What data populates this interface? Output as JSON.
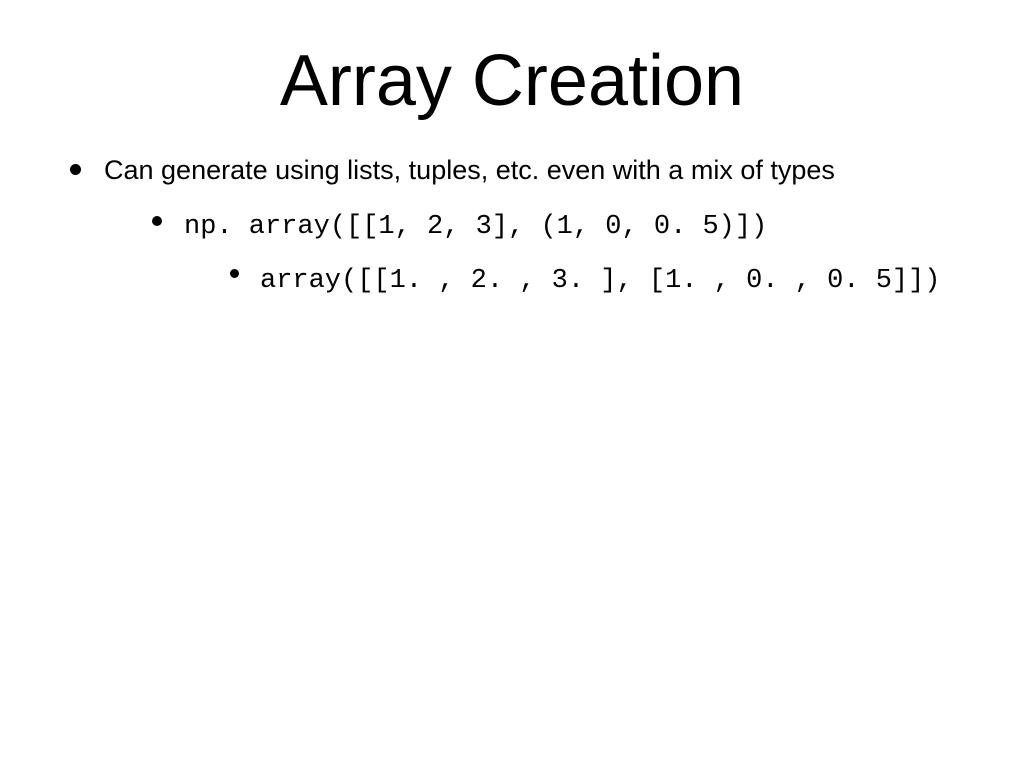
{
  "title": "Array Creation",
  "bullets": {
    "l1": "Can generate using lists, tuples, etc. even with a mix of types",
    "l2": "np. array([[1, 2, 3],  (1, 0, 0. 5)])",
    "l3": "array([[1. ,  2. ,  3. ], [1. ,  0. ,  0. 5]])"
  }
}
